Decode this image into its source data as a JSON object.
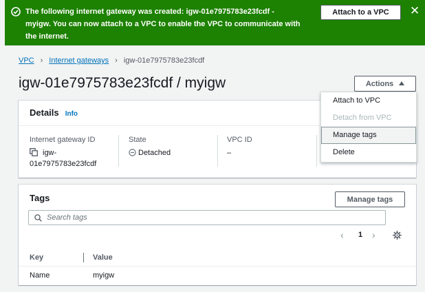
{
  "banner": {
    "message": "The following internet gateway was created: igw-01e7975783e23fcdf - myigw. You can now attach to a VPC to enable the VPC to communicate with the internet.",
    "attach_button": "Attach to a VPC",
    "close_symbol": "✕",
    "status_icon": "check-circle-icon",
    "color": "#1d8102"
  },
  "breadcrumb": {
    "items": [
      "VPC",
      "Internet gateways",
      "igw-01e7975783e23fcdf"
    ],
    "separator": "›"
  },
  "page": {
    "title": "igw-01e7975783e23fcdf / myigw"
  },
  "actions": {
    "label": "Actions",
    "menu": [
      {
        "label": "Attach to VPC",
        "disabled": false
      },
      {
        "label": "Detach from VPC",
        "disabled": true
      },
      {
        "label": "Manage tags",
        "disabled": false,
        "highlighted": true
      },
      {
        "label": "Delete",
        "disabled": false
      }
    ]
  },
  "details": {
    "title": "Details",
    "info_link": "Info",
    "fields": [
      {
        "label": "Internet gateway ID",
        "value_line1": "igw-",
        "value_line2": "01e7975783e23fcdf",
        "icon": "copy-icon"
      },
      {
        "label": "State",
        "value": "Detached",
        "icon": "detached-status-icon"
      },
      {
        "label": "VPC ID",
        "value": "–"
      }
    ]
  },
  "tags": {
    "title": "Tags",
    "manage_button": "Manage tags",
    "search_placeholder": "Search tags",
    "pagination": {
      "prev": "‹",
      "page": "1",
      "next": "›"
    },
    "columns": [
      "Key",
      "Value"
    ],
    "rows": [
      {
        "key": "Name",
        "value": "myigw"
      }
    ]
  },
  "colors": {
    "link": "#0073bb",
    "success": "#1d8102",
    "text": "#16191f"
  }
}
